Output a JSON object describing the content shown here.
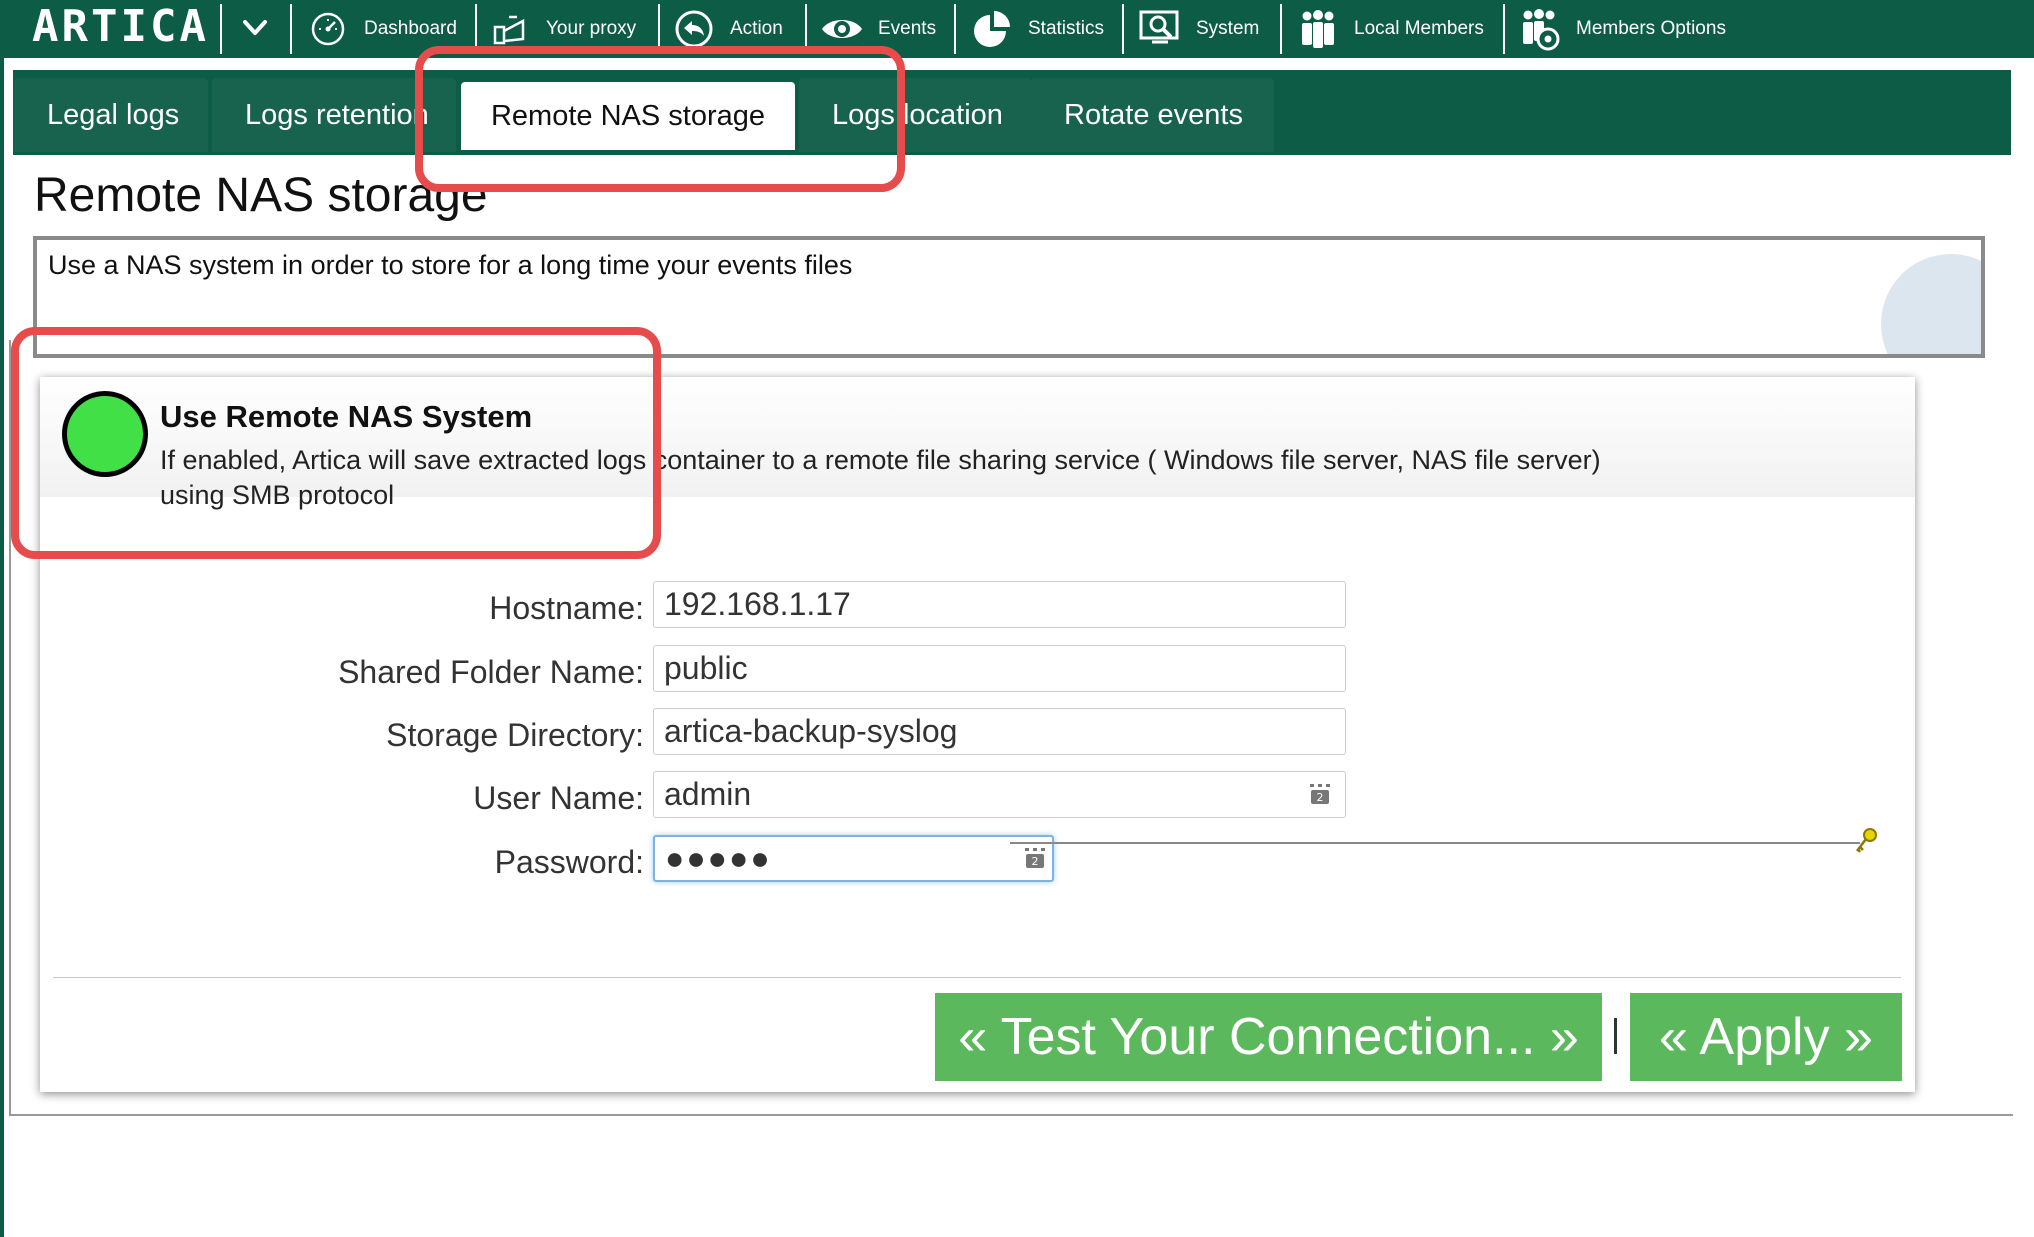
{
  "app": {
    "logo": "ARTICA"
  },
  "nav": {
    "items": [
      {
        "label": "Dashboard",
        "icon": "dashboard-icon"
      },
      {
        "label": "Your proxy",
        "icon": "proxy-icon"
      },
      {
        "label": "Action",
        "icon": "action-icon"
      },
      {
        "label": "Events",
        "icon": "eye-icon"
      },
      {
        "label": "Statistics",
        "icon": "pie-chart-icon"
      },
      {
        "label": "System",
        "icon": "system-icon"
      },
      {
        "label": "Local Members",
        "icon": "members-icon"
      },
      {
        "label": "Members Options",
        "icon": "members-options-icon"
      }
    ]
  },
  "tabs": [
    {
      "label": "Legal logs"
    },
    {
      "label": "Logs retention"
    },
    {
      "label": "Remote NAS storage",
      "active": true
    },
    {
      "label": "Logs location"
    },
    {
      "label": "Rotate events"
    }
  ],
  "page": {
    "title": "Remote NAS storage",
    "explain": "Use a NAS system in order to store for a long time your events files"
  },
  "option": {
    "title": "Use Remote NAS System",
    "description": "If enabled, Artica will save extracted logs container to a remote file sharing service ( Windows file server, NAS file server) using SMB protocol",
    "enabled": true
  },
  "form": {
    "hostname": {
      "label": "Hostname:",
      "value": "192.168.1.17"
    },
    "shared_folder": {
      "label": "Shared Folder Name:",
      "value": "public"
    },
    "storage_dir": {
      "label": "Storage Directory:",
      "value": "artica-backup-syslog"
    },
    "username": {
      "label": "User Name:",
      "value": "admin"
    },
    "password": {
      "label": "Password:",
      "value": "●●●●●"
    }
  },
  "buttons": {
    "test": "« Test Your Connection... »",
    "apply": "« Apply »"
  },
  "colors": {
    "brand": "#0d5c46",
    "button": "#5cb85c",
    "switch_on": "#41e047",
    "annotation": "#e74c4c"
  }
}
